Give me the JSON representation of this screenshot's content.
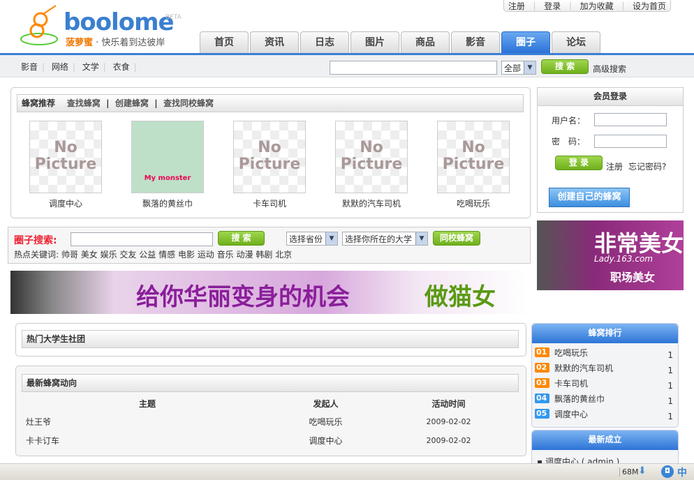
{
  "top_links": [
    "注册",
    "登录",
    "加为收藏",
    "设为首页"
  ],
  "logo": {
    "brand": "boolome",
    "beta": "BETA",
    "name": "菠萝蜜",
    "slogan": "· 快乐着到达彼岸"
  },
  "tabs": [
    {
      "label": "首页"
    },
    {
      "label": "资讯"
    },
    {
      "label": "日志"
    },
    {
      "label": "图片"
    },
    {
      "label": "商品"
    },
    {
      "label": "影音"
    },
    {
      "label": "圈子",
      "active": true
    },
    {
      "label": "论坛"
    }
  ],
  "subnav": [
    "影音",
    "网络",
    "文学",
    "衣食"
  ],
  "search": {
    "value": "",
    "scope": "全部",
    "button": "搜 索",
    "advanced": "高级搜索"
  },
  "hive": {
    "tabs": [
      "蜂窝推荐",
      "查找蜂窝",
      "创建蜂窝",
      "查找同校蜂窝"
    ],
    "items": [
      {
        "name": "调度中心",
        "img": "No Picture"
      },
      {
        "name": "飘落的黄丝巾",
        "img": "My monster"
      },
      {
        "name": "卡车司机",
        "img": "No Picture"
      },
      {
        "name": "默默的汽车司机",
        "img": "No Picture"
      },
      {
        "name": "吃喝玩乐",
        "img": "No Picture"
      }
    ]
  },
  "circle_search": {
    "label": "圈子搜索:",
    "button": "搜 索",
    "province": "选择省份",
    "university": "选择你所在的大学",
    "school_button": "同校蜂窝",
    "hot_label": "热点关键词:",
    "hot": [
      "帅哥",
      "美女",
      "娱乐",
      "交友",
      "公益",
      "情感",
      "电影",
      "运动",
      "音乐",
      "动漫",
      "韩剧",
      "北京"
    ]
  },
  "banner": {
    "text": "给你华丽变身的机会",
    "text2": "做猫女"
  },
  "hot_univ": {
    "title": "热门大学生社团"
  },
  "latest": {
    "title": "最新蜂窝动向",
    "columns": [
      "主题",
      "发起人",
      "活动时间"
    ],
    "rows": [
      [
        "灶王爷",
        "吃喝玩乐",
        "2009-02-02"
      ],
      [
        "卡卡订车",
        "调度中心",
        "2009-02-02"
      ]
    ]
  },
  "login": {
    "title": "会员登录",
    "user_label": "用户名：",
    "pass_label": "密　码：",
    "button": "登 录",
    "register": "注册",
    "forgot": "忘记密码?",
    "create": "创建自己的蜂窝"
  },
  "ad": {
    "text": "非常美女",
    "site": "Lady.163.com",
    "sub": "职场美女"
  },
  "ranking": {
    "title": "蜂窝排行",
    "items": [
      {
        "no": "01",
        "name": "吃喝玩乐",
        "count": "1"
      },
      {
        "no": "02",
        "name": "默默的汽车司机",
        "count": "1"
      },
      {
        "no": "03",
        "name": "卡车司机",
        "count": "1"
      },
      {
        "no": "04",
        "name": "飘落的黄丝巾",
        "count": "1"
      },
      {
        "no": "05",
        "name": "调度中心",
        "count": "1"
      }
    ]
  },
  "newest": {
    "title": "最新成立",
    "items": [
      "调度中心 ( admin )"
    ]
  },
  "statusbar": {
    "memory": "68M"
  }
}
